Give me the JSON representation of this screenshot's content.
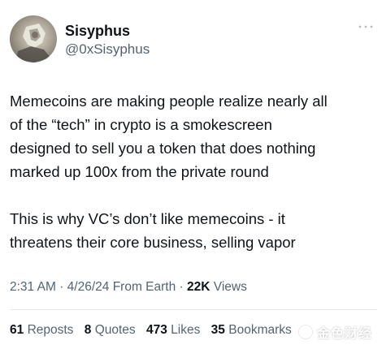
{
  "author": {
    "display_name": "Sisyphus",
    "handle": "@0xSisyphus"
  },
  "tweet": {
    "paragraphs": [
      "Memecoins are making people realize nearly all\nof the “tech” in crypto is a smokescreen\ndesigned to sell you a token that does nothing\nmarked up 100x from the private round",
      "This is why VC’s don’t like memecoins - it\nthreatens their core business, selling vapor"
    ]
  },
  "meta": {
    "time": "2:31 AM",
    "date": "4/26/24",
    "source": "From Earth",
    "views_count": "22K",
    "views_label": "Views",
    "separator": "·"
  },
  "stats": {
    "reposts": {
      "count": "61",
      "label": "Reposts"
    },
    "quotes": {
      "count": "8",
      "label": "Quotes"
    },
    "likes": {
      "count": "473",
      "label": "Likes"
    },
    "bookmarks": {
      "count": "35",
      "label": "Bookmarks"
    }
  },
  "watermark": {
    "text": "金色财经"
  },
  "icons": {
    "more": "more-horizontal-icon",
    "avatar": "avatar-image",
    "watermark_logo": "watermark-logo-icon"
  },
  "colors": {
    "text_primary": "#0f1419",
    "text_secondary": "#536471",
    "divider": "#e6e9ec",
    "background": "#ffffff"
  }
}
